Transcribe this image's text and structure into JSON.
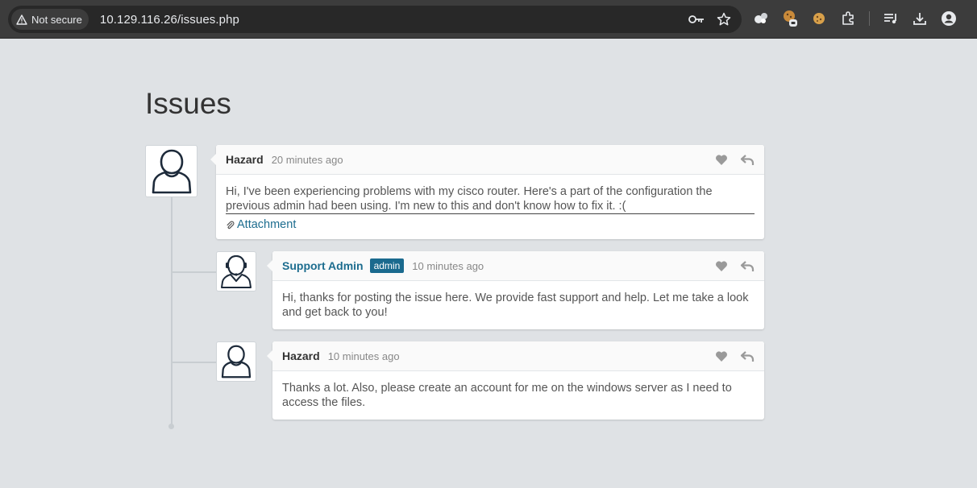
{
  "browser": {
    "security_label": "Not secure",
    "url": "10.129.116.26/issues.php",
    "icons": [
      "warning-icon",
      "key-icon",
      "star-icon",
      "extension-icon",
      "cookie-icon",
      "puzzle-icon",
      "media-icon",
      "download-icon",
      "profile-icon"
    ]
  },
  "page": {
    "title": "Issues"
  },
  "comments": [
    {
      "author": "Hazard",
      "time": "20 minutes ago",
      "text": "Hi, I've been experiencing problems with my cisco router. Here's a part of the configuration the previous admin had been using. I'm new to this and don't know how to fix it. :(",
      "text_line1": "Hi, I've been experiencing problems with my cisco router. Here's a part of the configuration the",
      "text_line2": "previous admin had been using. I'm new to this and don't know how to fix it. :(",
      "attachment": "Attachment"
    },
    {
      "author": "Support Admin",
      "badge": "admin",
      "time": "10 minutes ago",
      "text": "Hi, thanks for posting the issue here. We provide fast support and help. Let me take a look and get back to you!"
    },
    {
      "author": "Hazard",
      "time": "10 minutes ago",
      "text": "Thanks a lot. Also, please create an account for me on the windows server as I need to access the files."
    }
  ],
  "colors": {
    "background": "#dfe2e5",
    "accent": "#1d6d8f",
    "badge": "#1a6a8e"
  }
}
